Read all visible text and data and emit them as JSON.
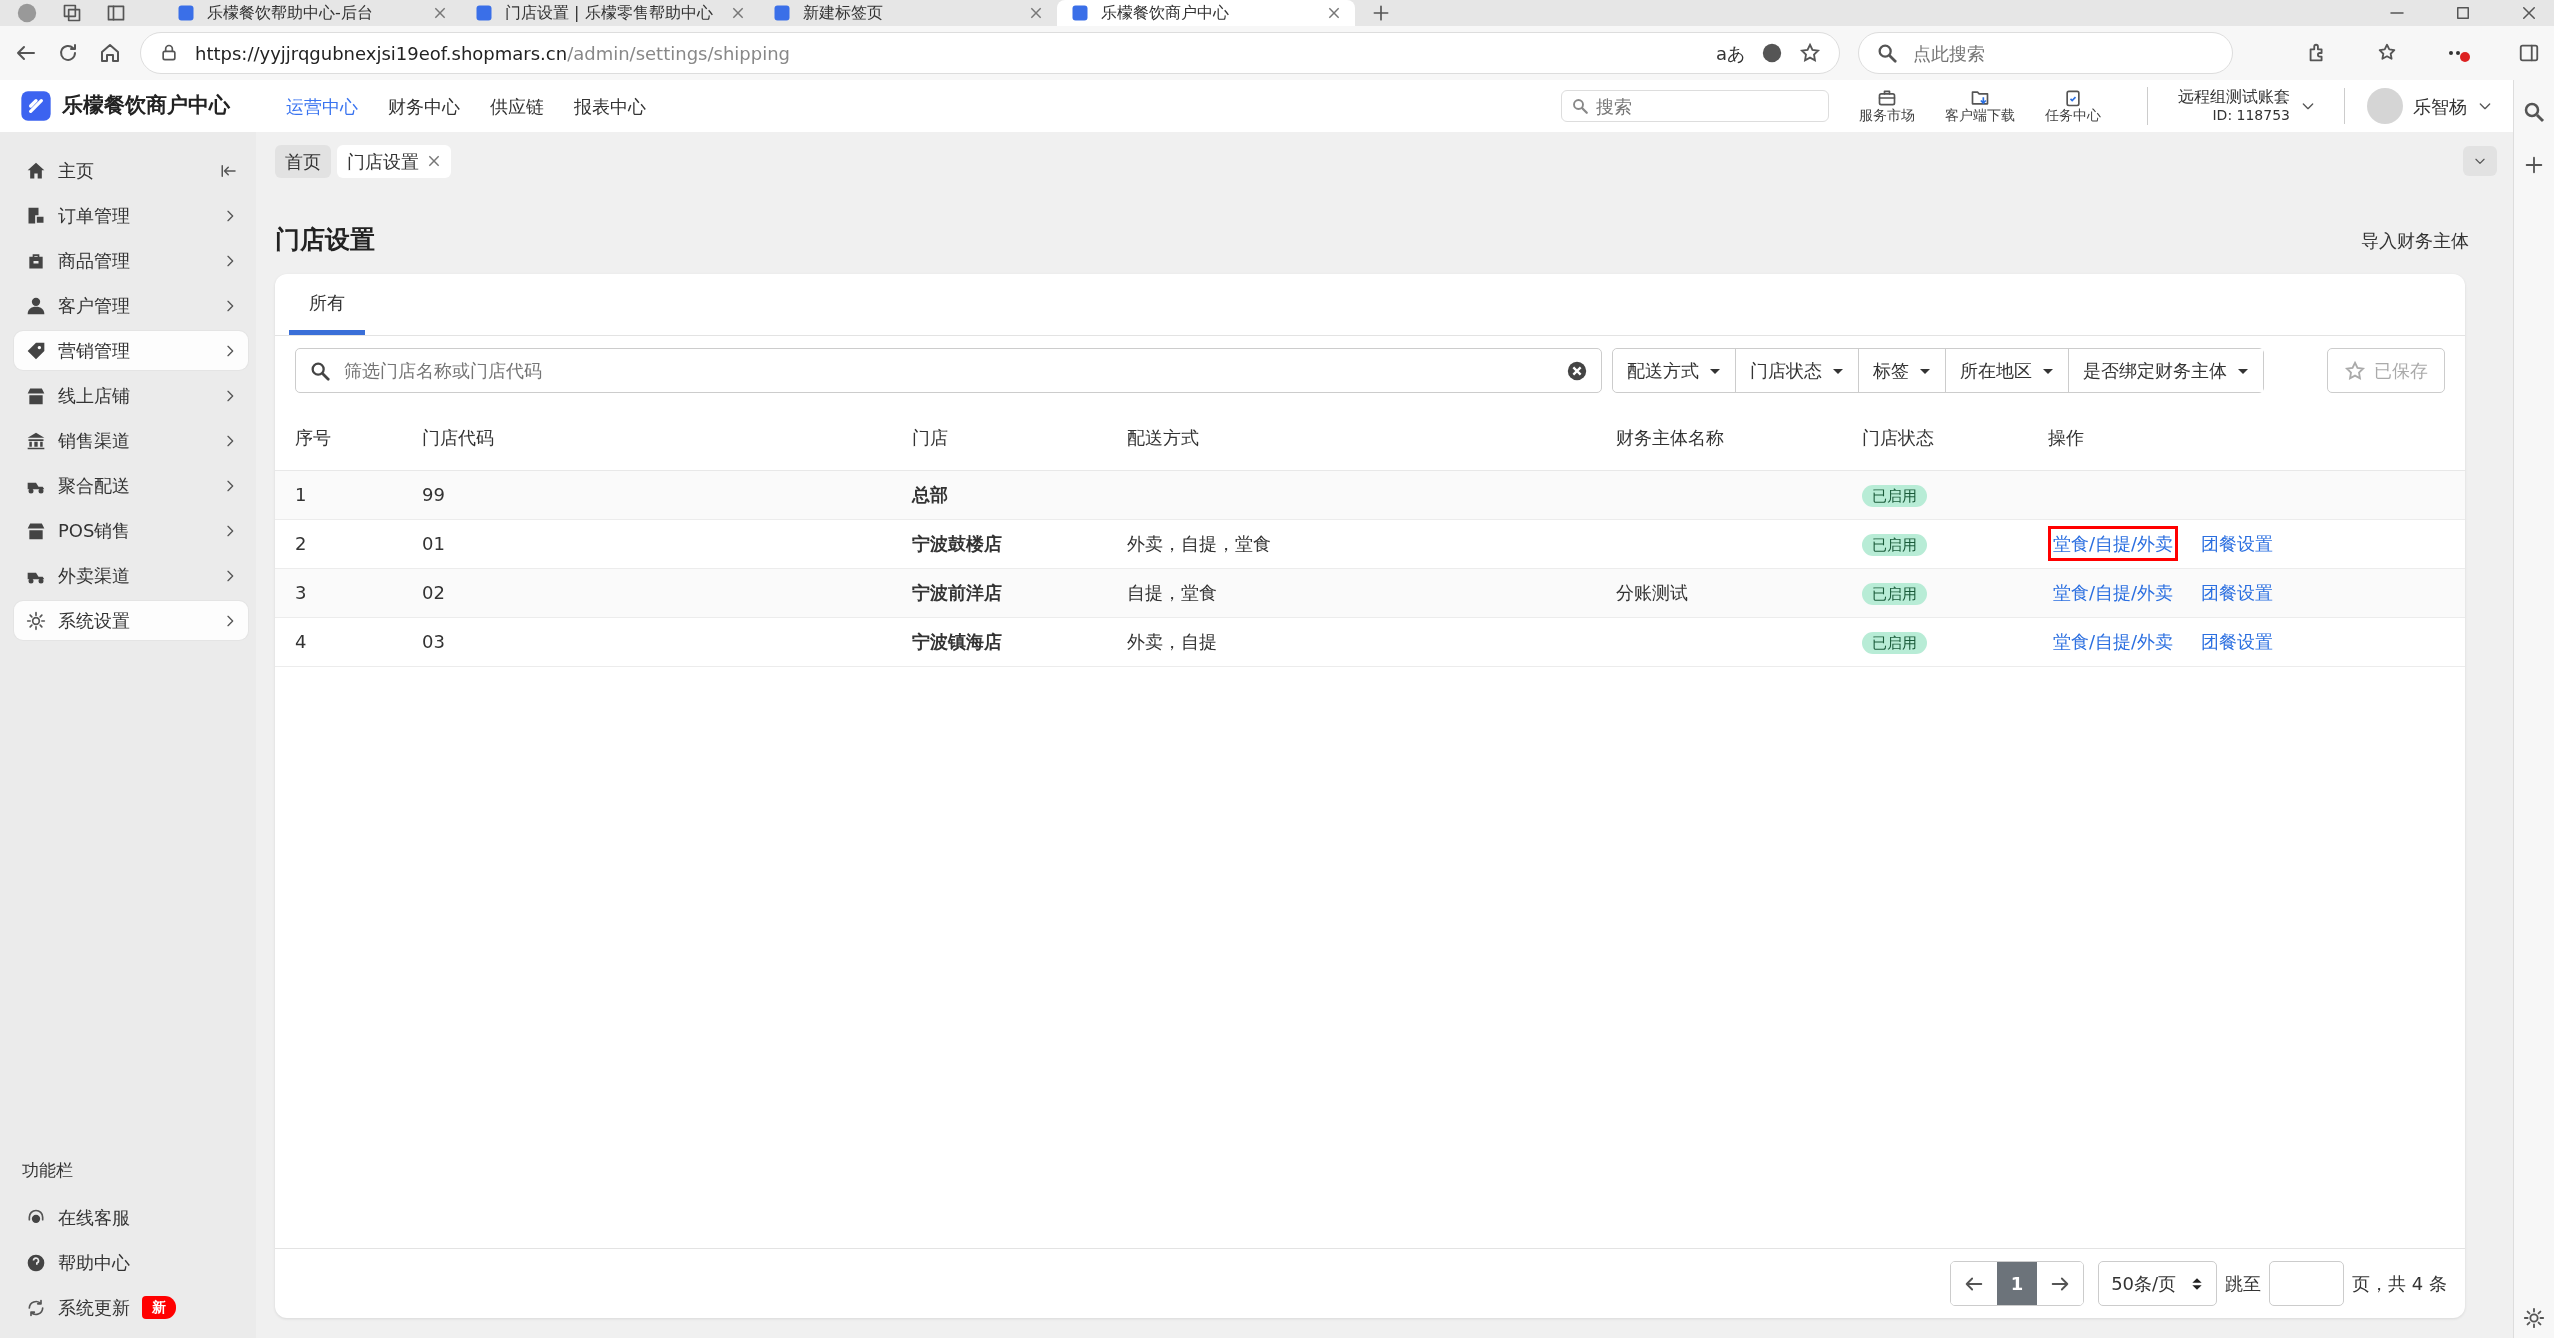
{
  "browser": {
    "tabs": [
      {
        "title": "乐檬餐饮帮助中心-后台",
        "selected": false
      },
      {
        "title": "门店设置 | 乐檬零售帮助中心",
        "selected": false
      },
      {
        "title": "新建标签页",
        "selected": false
      },
      {
        "title": "乐檬餐饮商户中心",
        "selected": true
      }
    ],
    "url": {
      "host": "https://yyjjrqgubnexjsi19eof.shopmars.cn",
      "path": "/admin/settings/shipping"
    },
    "translate_label": "aあ",
    "search_placeholder": "点此搜索"
  },
  "header": {
    "logo": "乐檬餐饮商户中心",
    "nav": [
      {
        "label": "运营中心",
        "selected": true
      },
      {
        "label": "财务中心",
        "selected": false
      },
      {
        "label": "供应链",
        "selected": false
      },
      {
        "label": "报表中心",
        "selected": false
      }
    ],
    "search_placeholder": "搜索",
    "tools": [
      {
        "label": "服务市场"
      },
      {
        "label": "客户端下载"
      },
      {
        "label": "任务中心"
      }
    ],
    "account": {
      "name": "远程组测试账套",
      "id": "ID: 118753"
    },
    "user": "乐智杨"
  },
  "sidebar": {
    "items": [
      {
        "label": "主页",
        "kind": "home",
        "selected": false
      },
      {
        "label": "订单管理",
        "kind": "menu",
        "selected": false
      },
      {
        "label": "商品管理",
        "kind": "menu",
        "selected": false
      },
      {
        "label": "客户管理",
        "kind": "menu",
        "selected": false
      },
      {
        "label": "营销管理",
        "kind": "menu",
        "selected": true
      },
      {
        "label": "线上店铺",
        "kind": "menu",
        "selected": false
      },
      {
        "label": "销售渠道",
        "kind": "menu",
        "selected": false
      },
      {
        "label": "聚合配送",
        "kind": "menu",
        "selected": false
      },
      {
        "label": "POS销售",
        "kind": "menu",
        "selected": false
      },
      {
        "label": "外卖渠道",
        "kind": "menu",
        "selected": false
      },
      {
        "label": "系统设置",
        "kind": "menu",
        "selected": true
      }
    ],
    "functions_title": "功能栏",
    "functions": [
      {
        "label": "在线客服"
      },
      {
        "label": "帮助中心"
      },
      {
        "label": "系统更新",
        "badge": "新"
      }
    ]
  },
  "breadcrumbs": [
    {
      "label": "首页",
      "selected": false,
      "closable": false
    },
    {
      "label": "门店设置",
      "selected": true,
      "closable": true
    }
  ],
  "page": {
    "title": "门店设置",
    "action": "导入财务主体",
    "tabs": [
      {
        "label": "所有",
        "selected": true
      }
    ],
    "filter_placeholder": "筛选门店名称或门店代码",
    "filters": [
      "配送方式",
      "门店状态",
      "标签",
      "所在地区",
      "是否绑定财务主体"
    ],
    "saved_button": {
      "label": "已保存",
      "disabled": true
    },
    "table": {
      "columns": [
        "序号",
        "门店代码",
        "门店",
        "配送方式",
        "财务主体名称",
        "门店状态",
        "操作"
      ],
      "rows": [
        {
          "index": "1",
          "code": "99",
          "store": "总部",
          "status": "已启用",
          "actions": []
        },
        {
          "index": "2",
          "code": "01",
          "store": "宁波鼓楼店",
          "delivery": "外卖，自提，堂食",
          "status": "已启用",
          "actions": [
            {
              "label": "堂食/自提/外卖",
              "highlighted": true
            },
            {
              "label": "团餐设置",
              "highlighted": false
            }
          ]
        },
        {
          "index": "3",
          "code": "02",
          "store": "宁波前洋店",
          "delivery": "自提，堂食",
          "entity": "分账测试",
          "status": "已启用",
          "actions": [
            {
              "label": "堂食/自提/外卖",
              "highlighted": false
            },
            {
              "label": "团餐设置",
              "highlighted": false
            }
          ]
        },
        {
          "index": "4",
          "code": "03",
          "store": "宁波镇海店",
          "delivery": "外卖，自提",
          "status": "已启用",
          "actions": [
            {
              "label": "堂食/自提/外卖",
              "highlighted": false
            },
            {
              "label": "团餐设置",
              "highlighted": false
            }
          ]
        }
      ]
    },
    "pagination": {
      "pages": [
        {
          "label": "1",
          "selected": true
        }
      ],
      "page_size": "50条/页",
      "jump_label": "跳至",
      "summary": "页，共 4 条"
    }
  }
}
